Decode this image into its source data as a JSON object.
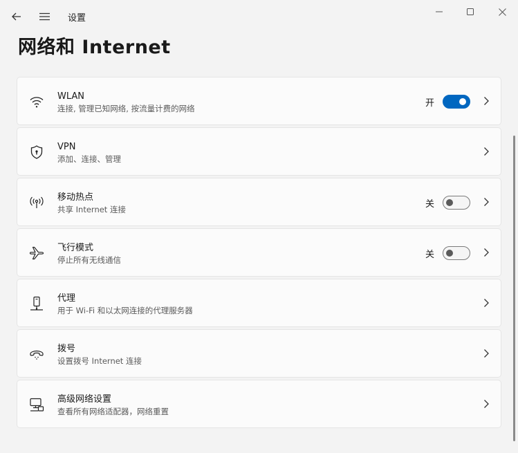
{
  "window": {
    "app_title": "设置",
    "controls": {
      "minimize": "minimize-icon",
      "maximize": "maximize-icon",
      "close": "close-icon"
    }
  },
  "page": {
    "title": "网络和 Internet"
  },
  "accent_color": "#0067c0",
  "items": [
    {
      "title": "WLAN",
      "subtitle": "连接, 管理已知网络, 按流量计费的网络",
      "icon": "wifi-icon",
      "toggle": {
        "label": "开",
        "on": true
      }
    },
    {
      "title": "VPN",
      "subtitle": "添加、连接、管理",
      "icon": "shield-icon"
    },
    {
      "title": "移动热点",
      "subtitle": "共享 Internet 连接",
      "icon": "hotspot-icon",
      "toggle": {
        "label": "关",
        "on": false
      }
    },
    {
      "title": "飞行模式",
      "subtitle": "停止所有无线通信",
      "icon": "airplane-icon",
      "toggle": {
        "label": "关",
        "on": false
      }
    },
    {
      "title": "代理",
      "subtitle": "用于 Wi-Fi 和以太网连接的代理服务器",
      "icon": "proxy-icon"
    },
    {
      "title": "拨号",
      "subtitle": "设置拨号 Internet 连接",
      "icon": "dialup-icon"
    },
    {
      "title": "高级网络设置",
      "subtitle": "查看所有网络适配器，网络重置",
      "icon": "network-adapter-icon"
    }
  ]
}
